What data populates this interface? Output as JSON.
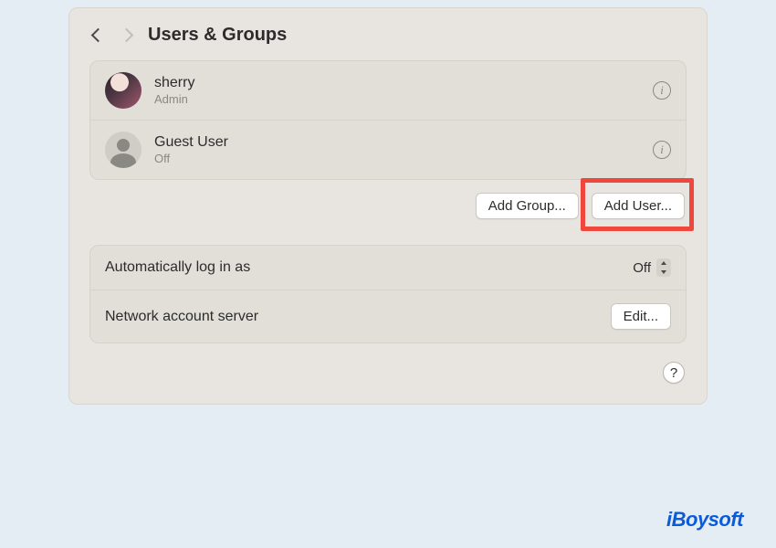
{
  "header": {
    "title": "Users & Groups"
  },
  "users": [
    {
      "name": "sherry",
      "role": "Admin"
    },
    {
      "name": "Guest User",
      "role": "Off"
    }
  ],
  "buttons": {
    "add_group": "Add Group...",
    "add_user": "Add User..."
  },
  "settings": {
    "auto_login_label": "Automatically log in as",
    "auto_login_value": "Off",
    "network_server_label": "Network account server",
    "edit_label": "Edit..."
  },
  "help_label": "?",
  "watermark": "iBoysoft"
}
